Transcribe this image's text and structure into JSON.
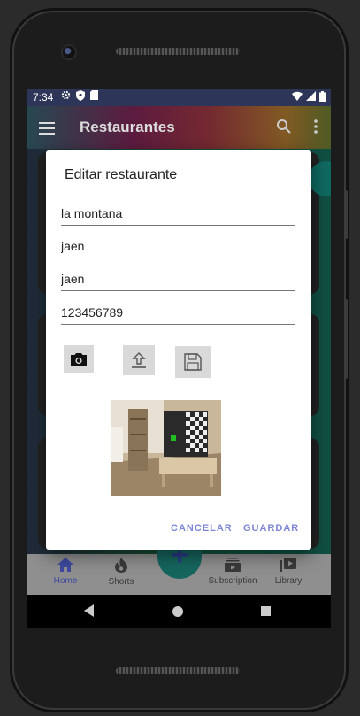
{
  "status_bar": {
    "time": "7:34",
    "left_icons": [
      "gear-icon",
      "shield-icon",
      "sd-card-icon"
    ],
    "right_icons": [
      "wifi-icon",
      "signal-icon",
      "battery-icon"
    ]
  },
  "app_bar": {
    "title": "Restaurantes",
    "icons": [
      "menu-icon",
      "search-icon",
      "overflow-icon"
    ]
  },
  "dialog": {
    "title": "Editar restaurante",
    "fields": [
      {
        "name": "nombre",
        "value": "la montana"
      },
      {
        "name": "ciudad",
        "value": "jaen"
      },
      {
        "name": "provincia",
        "value": "jaen"
      },
      {
        "name": "telefono",
        "value": "123456789"
      }
    ],
    "image_buttons": [
      "camera-icon",
      "upload-icon",
      "save-icon"
    ],
    "actions": {
      "cancel": "CANCELAR",
      "save": "GUARDAR"
    },
    "accent_color": "#7d86d6"
  },
  "bottom_nav": {
    "items": [
      {
        "label": "Home",
        "icon": "home-icon",
        "active": true
      },
      {
        "label": "Shorts",
        "icon": "flame-icon",
        "active": false
      },
      {
        "label": "Subscription",
        "icon": "subscriptions-icon",
        "active": false
      },
      {
        "label": "Library",
        "icon": "library-icon",
        "active": false
      }
    ],
    "center_action": "+"
  }
}
